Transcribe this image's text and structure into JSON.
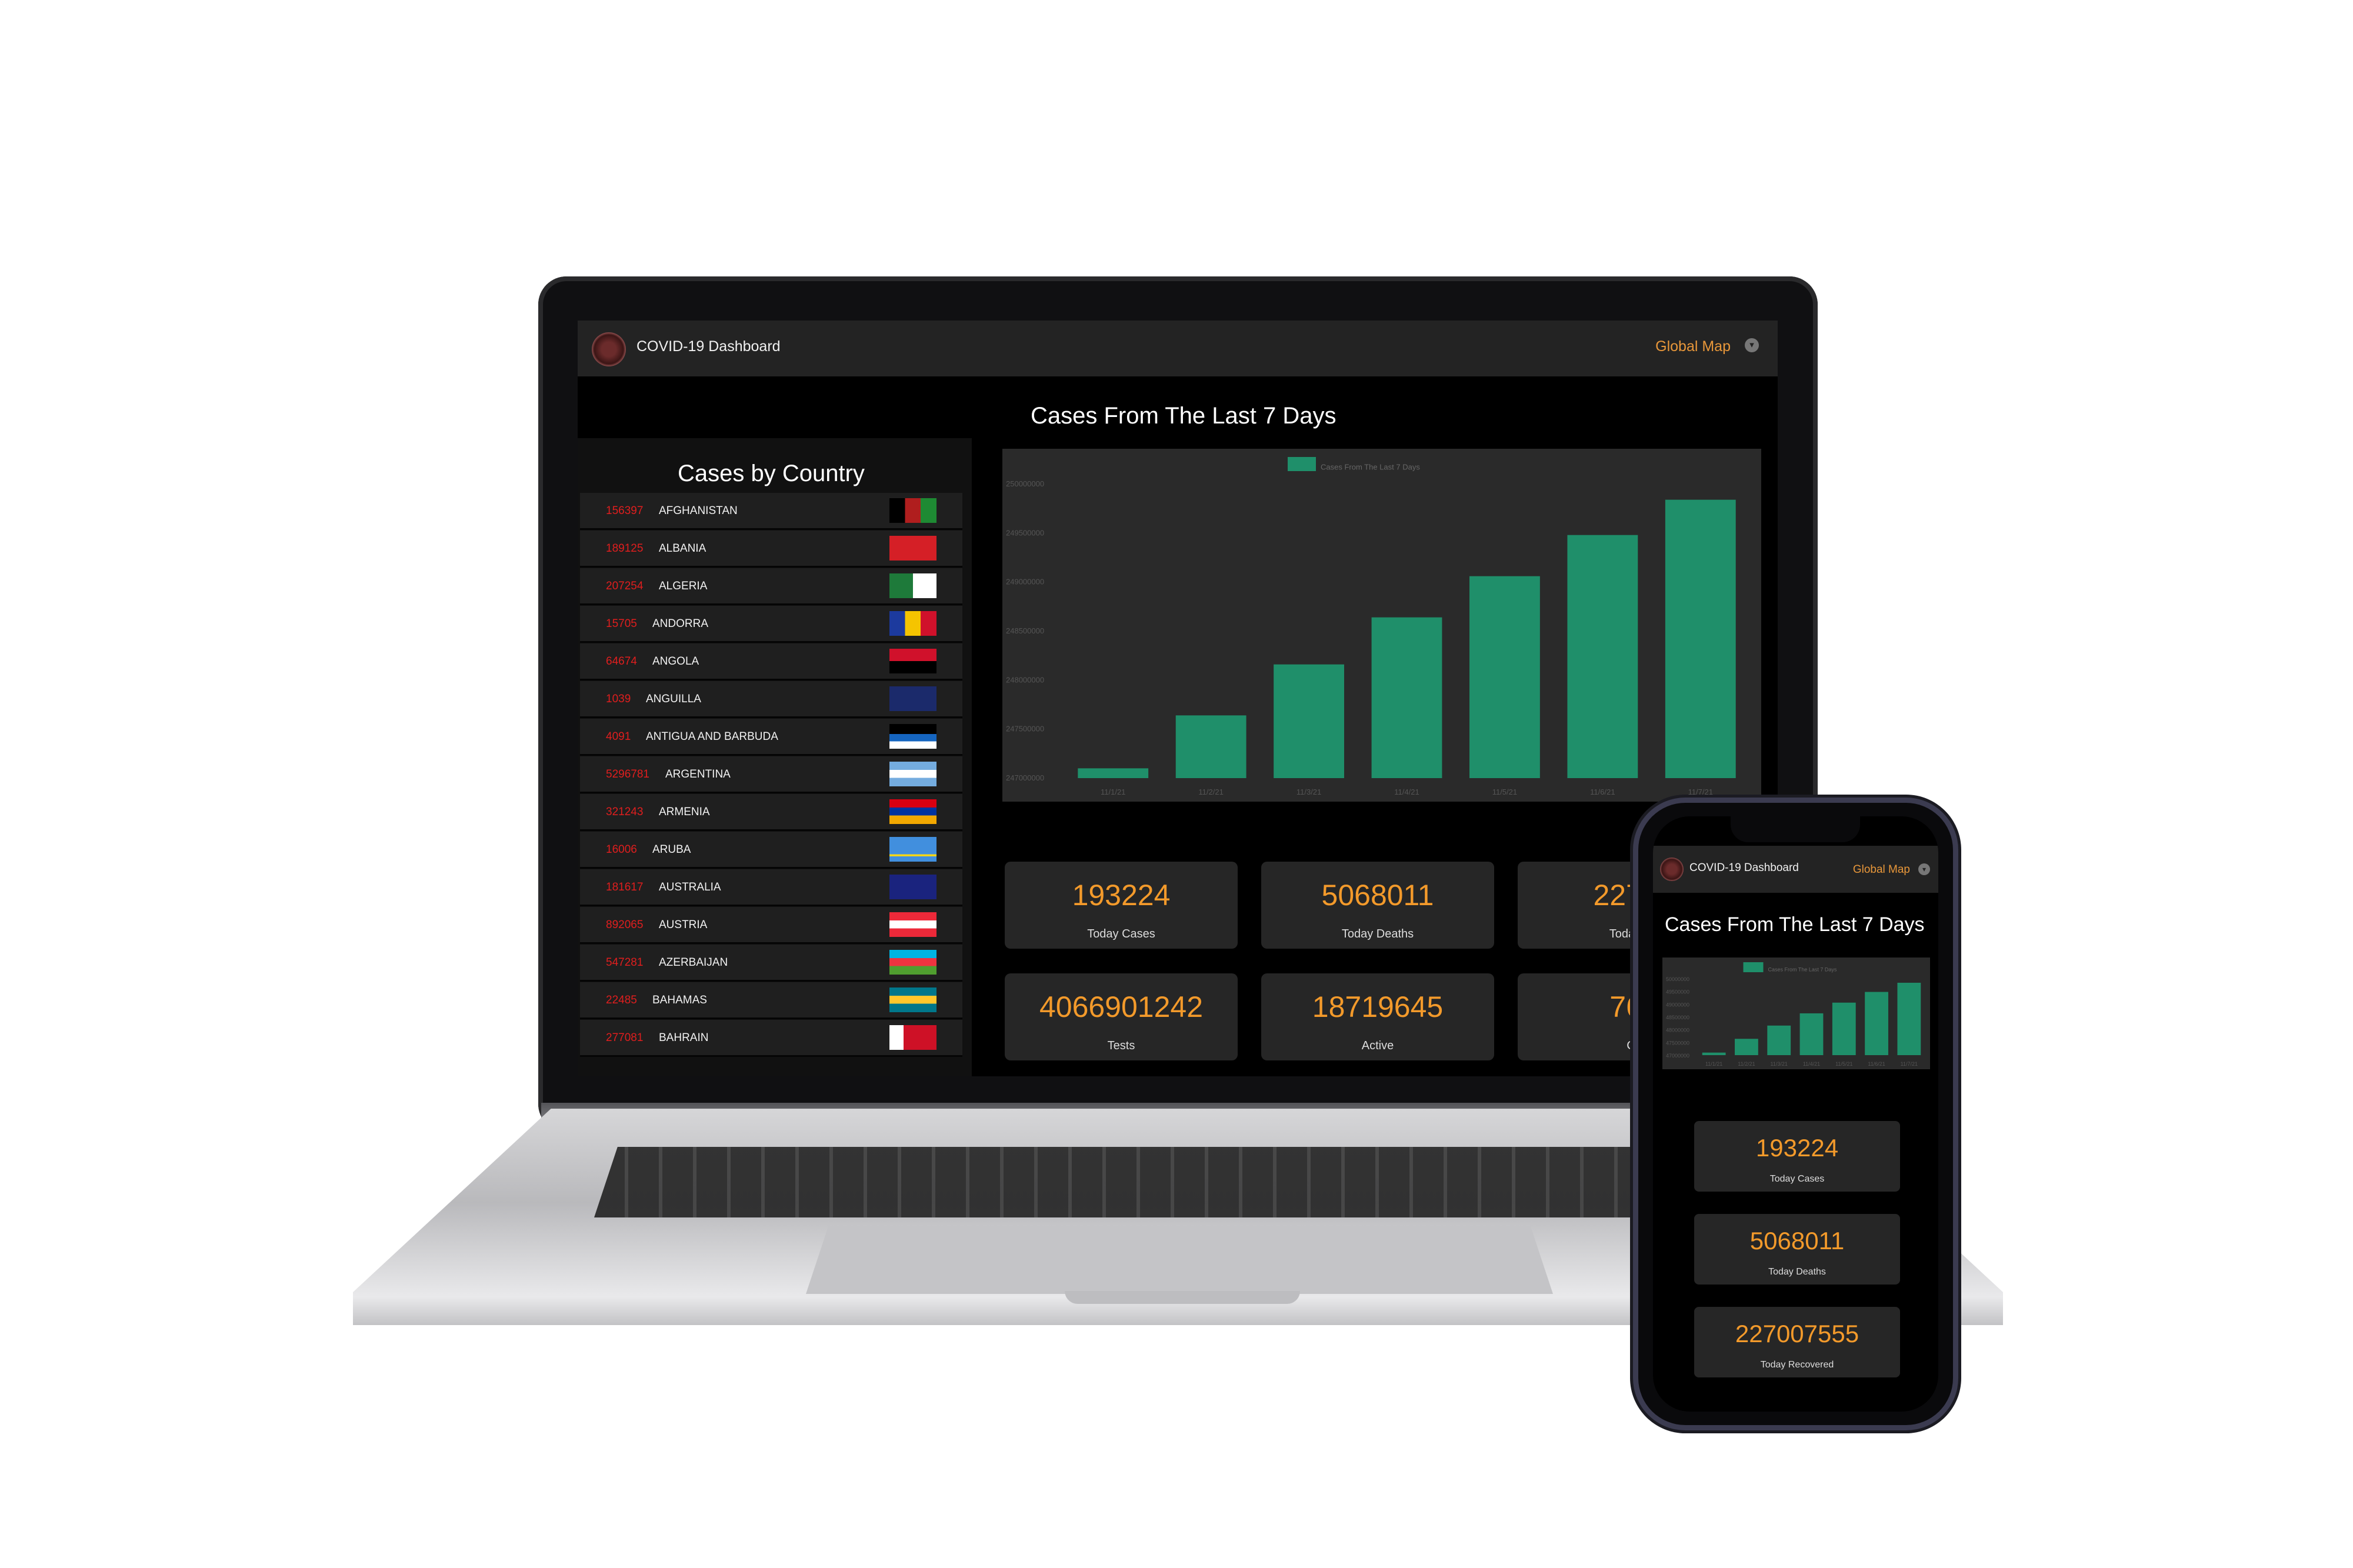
{
  "app": {
    "title": "COVID-19 Dashboard",
    "nav_label": "Global Map"
  },
  "chart_title": "Cases From The Last 7 Days",
  "countries_title": "Cases by Country",
  "countries": [
    {
      "num": "156397",
      "name": "AFGHANISTAN"
    },
    {
      "num": "189125",
      "name": "ALBANIA"
    },
    {
      "num": "207254",
      "name": "ALGERIA"
    },
    {
      "num": "15705",
      "name": "ANDORRA"
    },
    {
      "num": "64674",
      "name": "ANGOLA"
    },
    {
      "num": "1039",
      "name": "ANGUILLA"
    },
    {
      "num": "4091",
      "name": "ANTIGUA AND BARBUDA"
    },
    {
      "num": "5296781",
      "name": "ARGENTINA"
    },
    {
      "num": "321243",
      "name": "ARMENIA"
    },
    {
      "num": "16006",
      "name": "ARUBA"
    },
    {
      "num": "181617",
      "name": "AUSTRALIA"
    },
    {
      "num": "892065",
      "name": "AUSTRIA"
    },
    {
      "num": "547281",
      "name": "AZERBAIJAN"
    },
    {
      "num": "22485",
      "name": "BAHAMAS"
    },
    {
      "num": "277081",
      "name": "BAHRAIN"
    }
  ],
  "stats": [
    {
      "value": "193224",
      "label": "Today Cases"
    },
    {
      "value": "5068011",
      "label": "Today Deaths"
    },
    {
      "value": "22700",
      "label": "Today Re"
    },
    {
      "value": "4066901242",
      "label": "Tests"
    },
    {
      "value": "18719645",
      "label": "Active"
    },
    {
      "value": "764",
      "label": "Cri"
    }
  ],
  "phone_stats": [
    {
      "value": "193224",
      "label": "Today Cases"
    },
    {
      "value": "5068011",
      "label": "Today Deaths"
    },
    {
      "value": "227007555",
      "label": "Today Recovered"
    }
  ],
  "colors": {
    "bar": "#1f8f6a",
    "accent": "#f39a2b",
    "danger": "#e01e1e"
  },
  "chart_data": {
    "type": "bar",
    "legend": "Cases From The Last 7 Days",
    "categories": [
      "11/1/21",
      "11/2/21",
      "11/3/21",
      "11/4/21",
      "11/5/21",
      "11/6/21",
      "11/7/21"
    ],
    "values": [
      247050000,
      247320000,
      247580000,
      247820000,
      248030000,
      248240000,
      248420000
    ],
    "y_ticks": [
      "247000000",
      "247500000",
      "248000000",
      "248500000",
      "249000000",
      "249500000",
      "250000000"
    ],
    "ylim": [
      247000000,
      248500000
    ]
  },
  "phone_chart": {
    "legend": "Cases From The Last 7 Days",
    "y_ticks": [
      "47000000",
      "47500000",
      "48000000",
      "48500000",
      "49000000",
      "49500000",
      "50000000"
    ]
  }
}
